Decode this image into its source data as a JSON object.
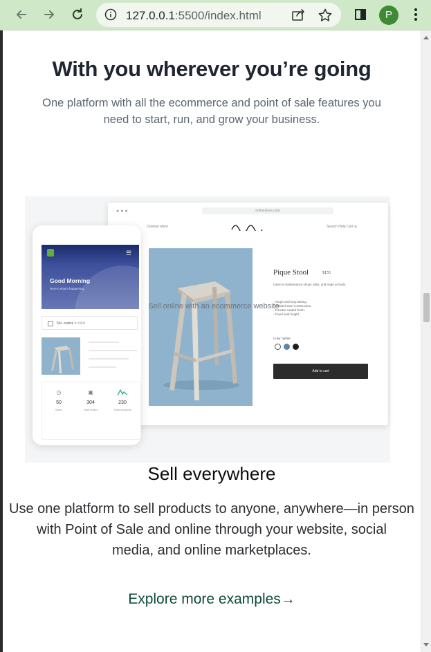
{
  "browser": {
    "url_host": "127.0.0.1",
    "url_path": ":5500/index.html",
    "profile_initial": "P",
    "chrome_color": "#cfe8c8",
    "profile_color": "#3f8a35",
    "icons": [
      "back-arrow-icon",
      "forward-arrow-icon",
      "reload-icon",
      "info-icon",
      "share-icon",
      "star-icon",
      "side-panel-icon",
      "more-vert-icon"
    ]
  },
  "hero": {
    "title": "With you wherever you’re going",
    "subtitle": "One platform with all the ecommerce and point of sale features you need to start, run, and grow your business."
  },
  "illustration": {
    "store_url": "onlinestore.com",
    "nav_left": "Outdoor   More",
    "nav_right": "Search   Help   Cart",
    "product_name": "Pique Stool",
    "product_price": "$155",
    "product_desc": "Used in maintenance shops, labs, and trade schools.",
    "product_bullets": [
      "- Tough and long lasting.",
      "- Welded steel construction.",
      "- Powder-coated finish.",
      "- Fixed seat height."
    ],
    "color_label": "Color: White",
    "swatches": [
      "#ffffff",
      "#5d86a6",
      "#1e1e1e"
    ],
    "add_to_cart": "Add to cart",
    "phone_greeting": "Good Morning",
    "phone_greeting_sub": "Here's what's happening.",
    "phone_orders": "50+ orders",
    "phone_orders_suffix": "to fulfill",
    "stats": [
      {
        "icon": "clock-icon",
        "value": "50",
        "label": "Sales"
      },
      {
        "icon": "inbox-icon",
        "value": "304",
        "label": "Total orders"
      },
      {
        "icon": "activity-icon",
        "value": "230",
        "label": "Total sessions"
      }
    ],
    "caption": "Sell online with an ecommerce website"
  },
  "sell": {
    "title": "Sell everywhere",
    "body_line1": "Use one platform to sell products to anyone, anywhere—in person with Point of Sale and online through your website, social",
    "body_line2": "media, and online marketplaces.",
    "link": "Explore more examples→"
  }
}
